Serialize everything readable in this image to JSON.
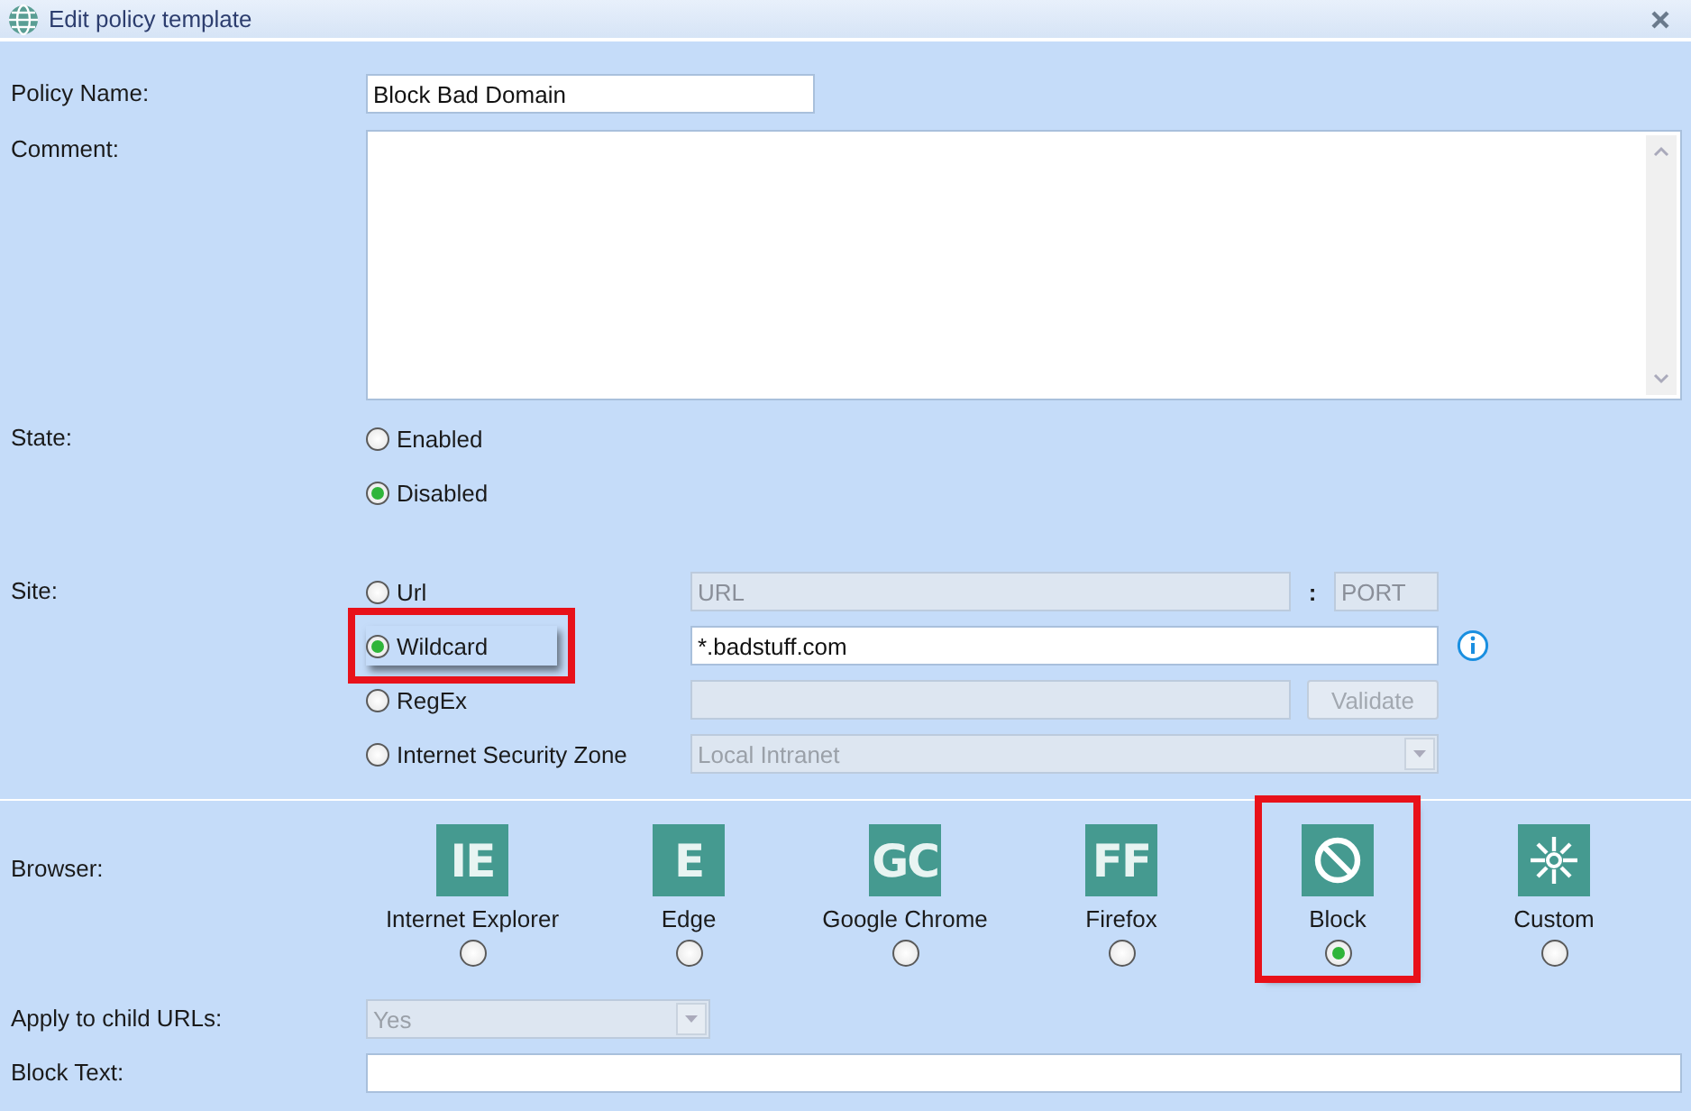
{
  "window": {
    "title": "Edit policy template"
  },
  "policy_name": {
    "label": "Policy Name:",
    "value": "Block Bad Domain"
  },
  "comment": {
    "label": "Comment:"
  },
  "state": {
    "label": "State:",
    "options": [
      {
        "label": "Enabled",
        "selected": false
      },
      {
        "label": "Disabled",
        "selected": true
      }
    ]
  },
  "site": {
    "label": "Site:",
    "options": [
      {
        "kind": "url",
        "label": "Url",
        "selected": false,
        "highlighted": false,
        "url_placeholder": "URL",
        "separator": ":",
        "port_placeholder": "PORT"
      },
      {
        "kind": "wildcard",
        "label": "Wildcard",
        "selected": true,
        "highlighted": true,
        "value": "*.badstuff.com"
      },
      {
        "kind": "regex",
        "label": "RegEx",
        "selected": false,
        "highlighted": false,
        "button": "Validate"
      },
      {
        "kind": "zone",
        "label": "Internet Security Zone",
        "selected": false,
        "highlighted": false,
        "value": "Local Intranet"
      }
    ]
  },
  "browser": {
    "label": "Browser:",
    "options": [
      {
        "kind": "letters",
        "letters": "IE",
        "label": "Internet Explorer",
        "selected": false,
        "highlighted": false
      },
      {
        "kind": "letters",
        "letters": "E",
        "label": "Edge",
        "selected": false,
        "highlighted": false
      },
      {
        "kind": "letters",
        "letters": "GC",
        "label": "Google Chrome",
        "selected": false,
        "highlighted": false
      },
      {
        "kind": "letters",
        "letters": "FF",
        "label": "Firefox",
        "selected": false,
        "highlighted": false
      },
      {
        "kind": "block",
        "label": "Block",
        "selected": true,
        "highlighted": true
      },
      {
        "kind": "custom",
        "label": "Custom",
        "selected": false,
        "highlighted": false
      }
    ]
  },
  "apply_to_child_urls": {
    "label": "Apply to child URLs:",
    "value": "Yes"
  },
  "block_text": {
    "label": "Block Text:"
  }
}
